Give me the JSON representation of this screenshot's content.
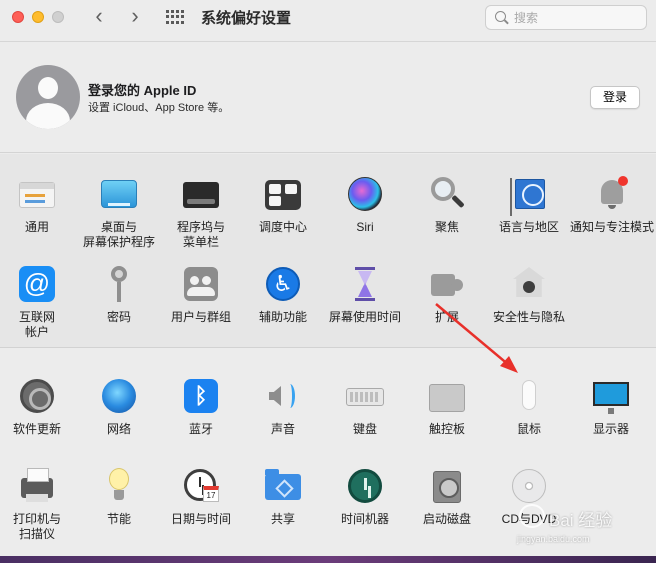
{
  "window": {
    "title": "系统偏好设置",
    "nav_back": "‹",
    "nav_forward": "›"
  },
  "search": {
    "placeholder": "搜索",
    "value": ""
  },
  "account": {
    "title": "登录您的 Apple ID",
    "subtitle": "设置 iCloud、App Store 等。",
    "login_button": "登录"
  },
  "section1": {
    "row1": [
      {
        "label": "通用",
        "icon": "general-icon"
      },
      {
        "label": "桌面与\n屏幕保护程序",
        "icon": "desktop-icon"
      },
      {
        "label": "程序坞与\n菜单栏",
        "icon": "dock-icon"
      },
      {
        "label": "调度中心",
        "icon": "mission-control-icon"
      },
      {
        "label": "Siri",
        "icon": "siri-icon"
      },
      {
        "label": "聚焦",
        "icon": "spotlight-icon"
      },
      {
        "label": "语言与地区",
        "icon": "language-icon"
      },
      {
        "label": "通知与专注模式",
        "icon": "notifications-icon"
      }
    ],
    "row2": [
      {
        "label": "互联网\n帐户",
        "icon": "internet-accounts-icon",
        "glyph": "@"
      },
      {
        "label": "密码",
        "icon": "key-icon"
      },
      {
        "label": "用户与群组",
        "icon": "users-icon"
      },
      {
        "label": "辅助功能",
        "icon": "accessibility-icon",
        "glyph": "♿"
      },
      {
        "label": "屏幕使用时间",
        "icon": "hourglass-icon"
      },
      {
        "label": "扩展",
        "icon": "puzzle-icon"
      },
      {
        "label": "安全性与隐私",
        "icon": "security-icon"
      }
    ]
  },
  "section2": {
    "row1": [
      {
        "label": "软件更新",
        "icon": "software-update-icon"
      },
      {
        "label": "网络",
        "icon": "network-icon"
      },
      {
        "label": "蓝牙",
        "icon": "bluetooth-icon",
        "glyph": "ᛒ"
      },
      {
        "label": "声音",
        "icon": "speaker-icon"
      },
      {
        "label": "键盘",
        "icon": "keyboard-icon"
      },
      {
        "label": "触控板",
        "icon": "trackpad-icon"
      },
      {
        "label": "鼠标",
        "icon": "mouse-icon"
      },
      {
        "label": "显示器",
        "icon": "display-icon"
      }
    ],
    "row2": [
      {
        "label": "打印机与\n扫描仪",
        "icon": "printer-icon"
      },
      {
        "label": "节能",
        "icon": "bulb-icon"
      },
      {
        "label": "日期与时间",
        "icon": "clock-icon",
        "cal_day": "17",
        "cal_month": "JUL"
      },
      {
        "label": "共享",
        "icon": "sharing-folder-icon"
      },
      {
        "label": "时间机器",
        "icon": "time-machine-icon"
      },
      {
        "label": "启动磁盘",
        "icon": "startup-disk-icon"
      },
      {
        "label": "CD与DVD",
        "icon": "cd-icon"
      }
    ]
  },
  "watermark": {
    "text": "Bai 经验",
    "subtext": "jingyan.baidu.com"
  },
  "colors": {
    "window_bg": "#ececec",
    "section1_bg": "#e6e6e6",
    "annotation_arrow": "#e8302a",
    "traffic_red": "#fe5f57",
    "traffic_yellow": "#febc2e"
  }
}
